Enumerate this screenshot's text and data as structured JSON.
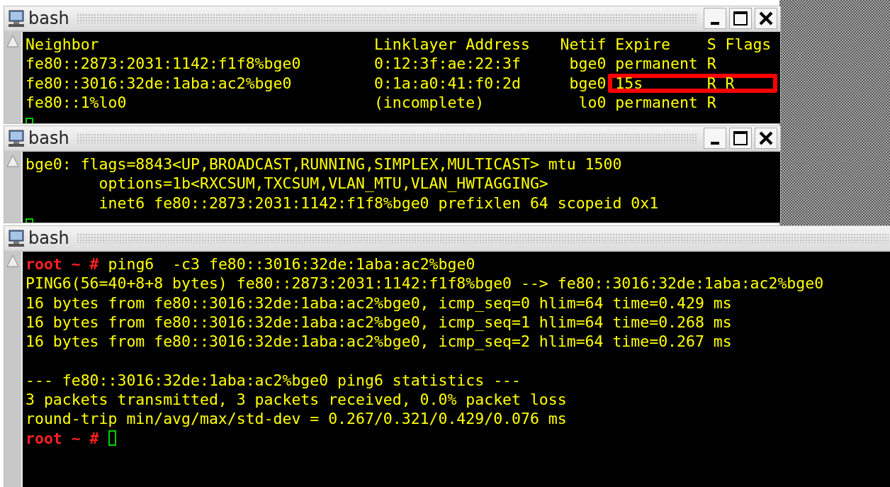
{
  "windows": [
    {
      "title": "bash",
      "kind": "table",
      "controls": true,
      "cursor": true,
      "table": {
        "columns": [
          "Neighbor",
          "Linklayer Address",
          "Netif",
          "Expire",
          "S",
          "Flags"
        ],
        "rows": [
          {
            "cells": [
              "fe80::2873:2031:1142:f1f8%bge0",
              "0:12:3f:ae:22:3f",
              "bge0",
              "permanent",
              "R"
            ],
            "highlighted": false
          },
          {
            "cells": [
              "fe80::3016:32de:1aba:ac2%bge0",
              "0:1a:a0:41:f0:2d",
              "bge0",
              "15s",
              "R",
              "R"
            ],
            "highlighted": true
          },
          {
            "cells": [
              "fe80::1%lo0",
              "(incomplete)",
              "lo0",
              "permanent",
              "R"
            ],
            "highlighted": false
          }
        ]
      }
    },
    {
      "title": "bash",
      "kind": "text",
      "controls": true,
      "cursor": true,
      "lines": [
        {
          "kind": "output",
          "text": "bge0: flags=8843<UP,BROADCAST,RUNNING,SIMPLEX,MULTICAST> mtu 1500"
        },
        {
          "kind": "output",
          "text": "        options=1b<RXCSUM,TXCSUM,VLAN_MTU,VLAN_HWTAGGING>"
        },
        {
          "kind": "output",
          "text": "        inet6 fe80::2873:2031:1142:f1f8%bge0 prefixlen 64 scopeid 0x1"
        }
      ]
    },
    {
      "title": "bash",
      "kind": "text",
      "controls": false,
      "cursor": false,
      "lines": [
        {
          "kind": "command",
          "prompt": "root ~ #",
          "text": "ping6  -c3 fe80::3016:32de:1aba:ac2%bge0",
          "cursor": false
        },
        {
          "kind": "output",
          "text": "PING6(56=40+8+8 bytes) fe80::2873:2031:1142:f1f8%bge0 --> fe80::3016:32de:1aba:ac2%bge0"
        },
        {
          "kind": "output",
          "text": "16 bytes from fe80::3016:32de:1aba:ac2%bge0, icmp_seq=0 hlim=64 time=0.429 ms"
        },
        {
          "kind": "output",
          "text": "16 bytes from fe80::3016:32de:1aba:ac2%bge0, icmp_seq=1 hlim=64 time=0.268 ms"
        },
        {
          "kind": "output",
          "text": "16 bytes from fe80::3016:32de:1aba:ac2%bge0, icmp_seq=2 hlim=64 time=0.267 ms"
        },
        {
          "kind": "blank"
        },
        {
          "kind": "output",
          "text": "--- fe80::3016:32de:1aba:ac2%bge0 ping6 statistics ---"
        },
        {
          "kind": "output",
          "text": "3 packets transmitted, 3 packets received, 0.0% packet loss"
        },
        {
          "kind": "output",
          "text": "round-trip min/avg/max/std-dev = 0.267/0.321/0.429/0.076 ms"
        },
        {
          "kind": "command",
          "prompt": "root ~ #",
          "cursor": true
        }
      ]
    }
  ]
}
